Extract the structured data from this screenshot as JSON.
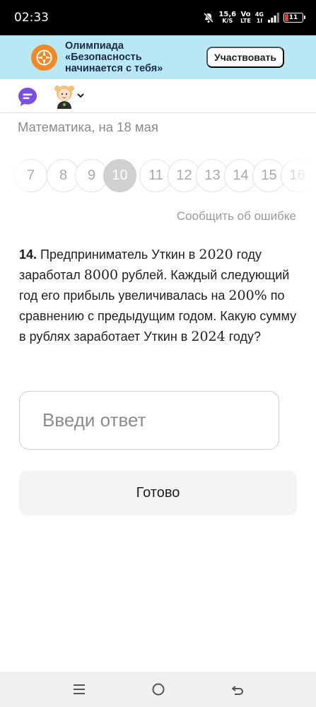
{
  "status_bar": {
    "time": "02:33",
    "net_speed_value": "15,6",
    "net_speed_unit": "K/S",
    "volte_top": "Vo",
    "volte_bottom": "LTE",
    "signal_top": "4G",
    "signal_bottom": "1l",
    "battery_level": "11",
    "battery_color": "#e53935"
  },
  "banner": {
    "title_line1": "Олимпиада",
    "title_line2": "«Безопасность",
    "title_line3": "начинается с тебя»",
    "button_label": "Участвовать",
    "background": "#b8e8f6",
    "logo_color": "#f08a28"
  },
  "header": {
    "chat_icon": "chat-bubble-icon",
    "chat_color": "#7b4fe0",
    "avatar": "avatar"
  },
  "subject": "Математика, на 18 мая",
  "pager": {
    "pages": [
      "7",
      "8",
      "9",
      "10",
      "11",
      "12",
      "13",
      "14",
      "15",
      "16"
    ],
    "active": "10"
  },
  "report_link": "Сообщить об ошибке",
  "task": {
    "number": "14.",
    "part1": "Предприниматель Уткин в ",
    "year1": "2020",
    "part2": " году заработал ",
    "amount": "8000",
    "part3": " рублей. Каждый следующий год его прибыль увеличивалась на ",
    "percent": "200%",
    "part4": " по сравнению с предыдущим годом. Какую сумму в рублях заработает Уткин в ",
    "year2": "2024",
    "part5": " году?"
  },
  "answer_input": {
    "placeholder": "Введи ответ",
    "value": ""
  },
  "done_button": "Готово",
  "nav": {
    "recents": "menu-icon",
    "home": "home-circle-icon",
    "back": "back-icon"
  }
}
